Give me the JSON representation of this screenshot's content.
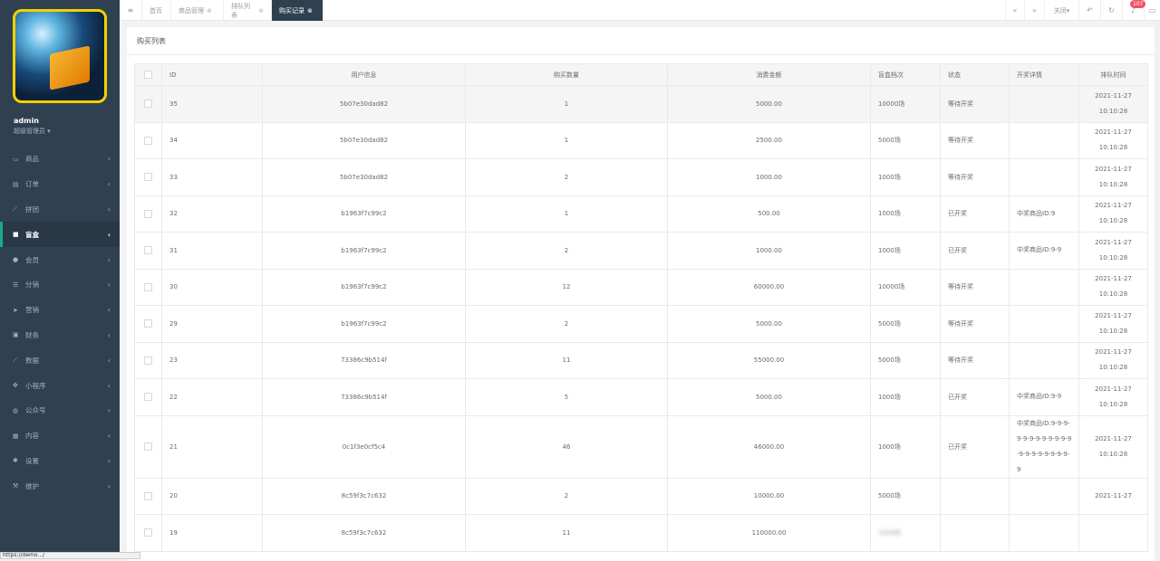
{
  "sidebar": {
    "user_name": "admin",
    "user_role": "超级管理员",
    "items": [
      {
        "label": "商品",
        "icon": "laptop-icon",
        "glyph": "▭"
      },
      {
        "label": "订单",
        "icon": "file-icon",
        "glyph": "▤"
      },
      {
        "label": "拼团",
        "icon": "chart-line-icon",
        "glyph": "⟋"
      },
      {
        "label": "盲盒",
        "icon": "square-icon",
        "glyph": "■",
        "active": true
      },
      {
        "label": "会员",
        "icon": "user-icon",
        "glyph": "●"
      },
      {
        "label": "分销",
        "icon": "users-icon",
        "glyph": "☰"
      },
      {
        "label": "营销",
        "icon": "send-icon",
        "glyph": "➤"
      },
      {
        "label": "财务",
        "icon": "money-icon",
        "glyph": "▣"
      },
      {
        "label": "数据",
        "icon": "chart-area-icon",
        "glyph": "⟋"
      },
      {
        "label": "小程序",
        "icon": "cubes-icon",
        "glyph": "✥"
      },
      {
        "label": "公众号",
        "icon": "wechat-icon",
        "glyph": "◍"
      },
      {
        "label": "内容",
        "icon": "book-icon",
        "glyph": "▦"
      },
      {
        "label": "设置",
        "icon": "gear-icon",
        "glyph": "✱"
      },
      {
        "label": "维护",
        "icon": "wrench-icon",
        "glyph": "⚒"
      }
    ]
  },
  "topbar": {
    "menu_glyph": "≡",
    "tabs": [
      {
        "label": "首页",
        "closable": false
      },
      {
        "label": "商品管理",
        "closable": true
      },
      {
        "label": "排队列表",
        "closable": true
      },
      {
        "label": "购买记录",
        "closable": true,
        "active": true
      }
    ],
    "close_label": "关闭",
    "notification_count": "107"
  },
  "panel": {
    "title": "购买列表"
  },
  "table": {
    "headers": [
      "ID",
      "用户信息",
      "购买数量",
      "消费金额",
      "盲盒档次",
      "状态",
      "开奖详情",
      "排队时间"
    ],
    "rows": [
      {
        "id": "35",
        "user": "5b07e30dad82",
        "qty": "1",
        "amount": "5000.00",
        "tier": "10000场",
        "status": "等待开奖",
        "detail": "",
        "date": "2021-11-27",
        "time": "10:10:28"
      },
      {
        "id": "34",
        "user": "5b07e30dad82",
        "qty": "1",
        "amount": "2500.00",
        "tier": "5000场",
        "status": "等待开奖",
        "detail": "",
        "date": "2021-11-27",
        "time": "10:10:28"
      },
      {
        "id": "33",
        "user": "5b07e30dad82",
        "qty": "2",
        "amount": "1000.00",
        "tier": "1000场",
        "status": "等待开奖",
        "detail": "",
        "date": "2021-11-27",
        "time": "10:10:28"
      },
      {
        "id": "32",
        "user": "b1963f7c99c2",
        "qty": "1",
        "amount": "500.00",
        "tier": "1000场",
        "status": "已开奖",
        "detail": "中奖商品ID:9",
        "date": "2021-11-27",
        "time": "10:10:28"
      },
      {
        "id": "31",
        "user": "b1963f7c99c2",
        "qty": "2",
        "amount": "1000.00",
        "tier": "1000场",
        "status": "已开奖",
        "detail": "中奖商品ID:9-9",
        "date": "2021-11-27",
        "time": "10:10:28"
      },
      {
        "id": "30",
        "user": "b1963f7c99c2",
        "qty": "12",
        "amount": "60000.00",
        "tier": "10000场",
        "status": "等待开奖",
        "detail": "",
        "date": "2021-11-27",
        "time": "10:10:28"
      },
      {
        "id": "29",
        "user": "b1963f7c99c2",
        "qty": "2",
        "amount": "5000.00",
        "tier": "5000场",
        "status": "等待开奖",
        "detail": "",
        "date": "2021-11-27",
        "time": "10:10:28"
      },
      {
        "id": "23",
        "user": "73386c9b514f",
        "qty": "11",
        "amount": "55000.00",
        "tier": "5000场",
        "status": "等待开奖",
        "detail": "",
        "date": "2021-11-27",
        "time": "10:10:28"
      },
      {
        "id": "22",
        "user": "73386c9b514f",
        "qty": "5",
        "amount": "5000.00",
        "tier": "1000场",
        "status": "已开奖",
        "detail": "中奖商品ID:9-9",
        "date": "2021-11-27",
        "time": "10:10:28"
      },
      {
        "id": "21",
        "user": "0c1f3e0cf5c4",
        "qty": "46",
        "amount": "46000.00",
        "tier": "1000场",
        "status": "已开奖",
        "detail": "中奖商品ID:9-9-9-9-9-9-9-9-9-9-9-9-9-9-9-9-9-9-9-9-9",
        "date": "2021-11-27",
        "time": "10:10:28"
      },
      {
        "id": "20",
        "user": "8c59f3c7c632",
        "qty": "2",
        "amount": "10000.00",
        "tier": "5000场",
        "status": "",
        "detail": "",
        "date": "2021-11-27",
        "time": ""
      },
      {
        "id": "19",
        "user": "8c59f3c7c632",
        "qty": "11",
        "amount": "110000.00",
        "tier": "1000场",
        "status": "",
        "detail": "",
        "date": "",
        "time": ""
      }
    ]
  },
  "statusbar_text": "https://demo.../"
}
